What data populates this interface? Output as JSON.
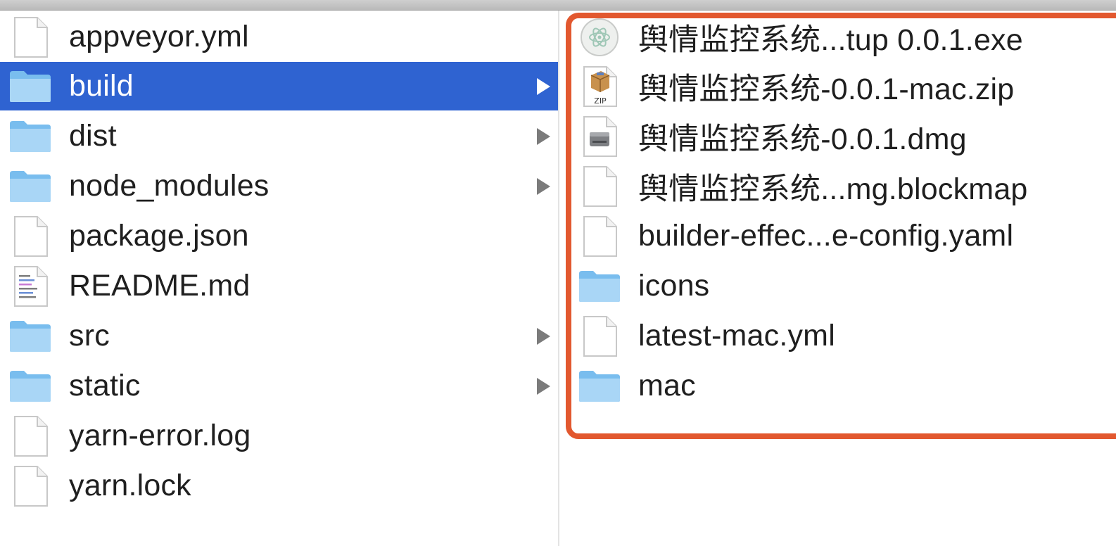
{
  "left_column": {
    "items": [
      {
        "name": "appveyor.yml",
        "kind": "file",
        "has_children": false
      },
      {
        "name": "build",
        "kind": "folder",
        "has_children": true,
        "selected": true
      },
      {
        "name": "dist",
        "kind": "folder",
        "has_children": true
      },
      {
        "name": "node_modules",
        "kind": "folder",
        "has_children": true
      },
      {
        "name": "package.json",
        "kind": "file",
        "has_children": false
      },
      {
        "name": "README.md",
        "kind": "text-file",
        "has_children": false
      },
      {
        "name": "src",
        "kind": "folder",
        "has_children": true
      },
      {
        "name": "static",
        "kind": "folder",
        "has_children": true
      },
      {
        "name": "yarn-error.log",
        "kind": "file",
        "has_children": false
      },
      {
        "name": "yarn.lock",
        "kind": "file",
        "has_children": false
      }
    ]
  },
  "right_column": {
    "items": [
      {
        "name": "舆情监控系统...tup 0.0.1.exe",
        "kind": "electron-exe"
      },
      {
        "name": "舆情监控系统-0.0.1-mac.zip",
        "kind": "zip-archive"
      },
      {
        "name": "舆情监控系统-0.0.1.dmg",
        "kind": "disk-image"
      },
      {
        "name": "舆情监控系统...mg.blockmap",
        "kind": "file"
      },
      {
        "name": "builder-effec...e-config.yaml",
        "kind": "file"
      },
      {
        "name": "icons",
        "kind": "folder"
      },
      {
        "name": "latest-mac.yml",
        "kind": "file"
      },
      {
        "name": "mac",
        "kind": "folder"
      }
    ]
  },
  "colors": {
    "selection": "#2f63d1",
    "highlight_border": "#e2582f",
    "folder": "#9fd0f3"
  }
}
